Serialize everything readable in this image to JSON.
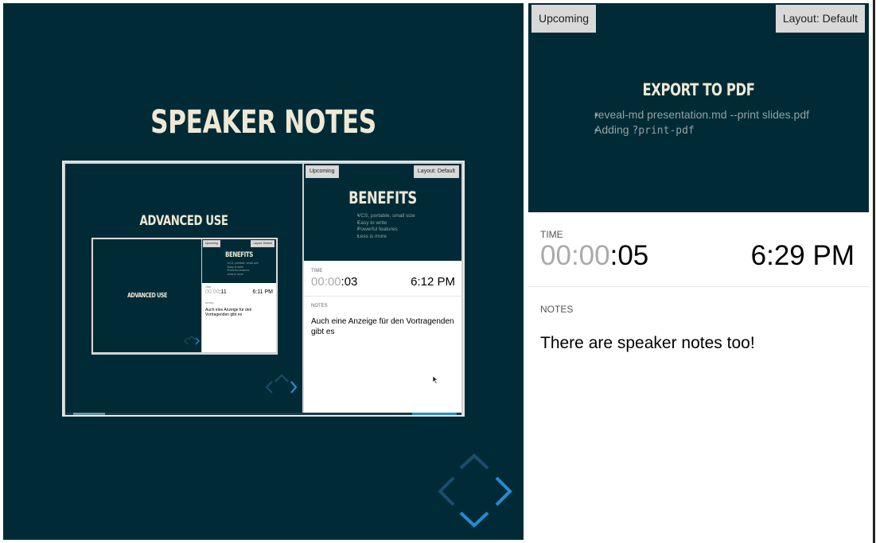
{
  "colors": {
    "slide_bg": "#002b36",
    "title": "#eee8d5",
    "text": "#93a1a1",
    "nav": "#268bd2",
    "panel_bg": "#ffffff",
    "label_bg": "#d9d9d9"
  },
  "current_slide": {
    "title": "SPEAKER NOTES",
    "nav_icons": [
      "chevron-left-icon",
      "chevron-up-icon",
      "chevron-right-icon",
      "chevron-down-icon"
    ]
  },
  "upcoming_panel": {
    "label": "Upcoming",
    "layout_button": "Layout: Default",
    "slide_title": "EXPORT TO PDF",
    "bullets": [
      {
        "text": "reveal-md presentation.md --print slides.pdf",
        "code": ""
      },
      {
        "text": "Adding ",
        "code": "?print-pdf"
      }
    ]
  },
  "time_panel": {
    "label": "TIME",
    "timer_hours": "00",
    "timer_minutes": "00",
    "timer_seconds": "05",
    "sep": ":",
    "clock": "6:29 PM"
  },
  "notes_panel": {
    "label": "NOTES",
    "text": "There are speaker notes too!"
  },
  "embedded_level1": {
    "slide_title": "ADVANCED USE",
    "upcoming_label": "Upcoming",
    "layout_button": "Layout: Default",
    "upcoming_title": "BENEFITS",
    "upcoming_bullets": [
      "VCS, portable, small size",
      "Easy to write",
      "Powerful features",
      "Less is more"
    ],
    "time_label": "TIME",
    "timer_hours": "00",
    "timer_minutes": "00",
    "timer_seconds": "03",
    "clock": "6:12 PM",
    "notes_label": "NOTES",
    "notes_text": "Auch eine Anzeige für den Vortragenden gibt es"
  },
  "embedded_level2": {
    "slide_title": "ADVANCED USE",
    "upcoming_label": "Upcoming",
    "layout_button": "Layout: Default",
    "upcoming_title": "BENEFITS",
    "upcoming_bullets": [
      "VCS, portable, small size",
      "Easy to write",
      "Powerful features",
      "Less is more"
    ],
    "time_label": "TIME",
    "timer_hours": "00",
    "timer_minutes": "00",
    "timer_seconds": "11",
    "clock": "6:11 PM",
    "notes_label": "NOTES",
    "notes_text": "Auch eine Anzeige für den Vortragenden gibt es"
  }
}
